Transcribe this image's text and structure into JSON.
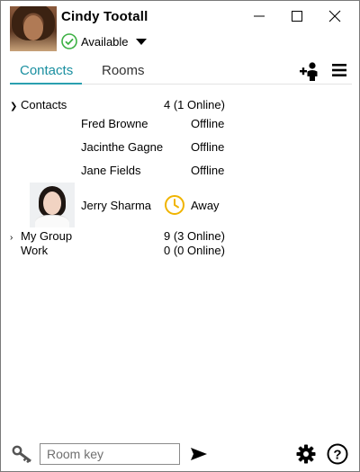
{
  "user": {
    "name": "Cindy Tootall",
    "status": "Available",
    "status_color": "#3cb043"
  },
  "tabs": [
    {
      "label": "Contacts",
      "active": true
    },
    {
      "label": "Rooms",
      "active": false
    }
  ],
  "accent_color": "#2aa0b0",
  "icons": {
    "add_contact": "add-contact-icon",
    "menu": "hamburger-menu-icon",
    "away": "clock-icon",
    "key": "key-icon",
    "send": "send-icon",
    "settings": "gear-icon",
    "help": "help-icon"
  },
  "groups": [
    {
      "name": "Contacts",
      "count": "4 (1 Online)",
      "expanded": true,
      "members": [
        {
          "name": "Fred Browne",
          "status": "Offline"
        },
        {
          "name": "Jacinthe Gagne",
          "status": "Offline"
        },
        {
          "name": "Jane Fields",
          "status": "Offline"
        },
        {
          "name": "Jerry Sharma",
          "status": "Away"
        }
      ]
    },
    {
      "name": "My Group",
      "count": "9 (3 Online)",
      "expanded": false
    },
    {
      "name": "Work",
      "count": "0 (0 Online)",
      "expanded": false
    }
  ],
  "room_input": {
    "placeholder": "Room key",
    "value": ""
  }
}
